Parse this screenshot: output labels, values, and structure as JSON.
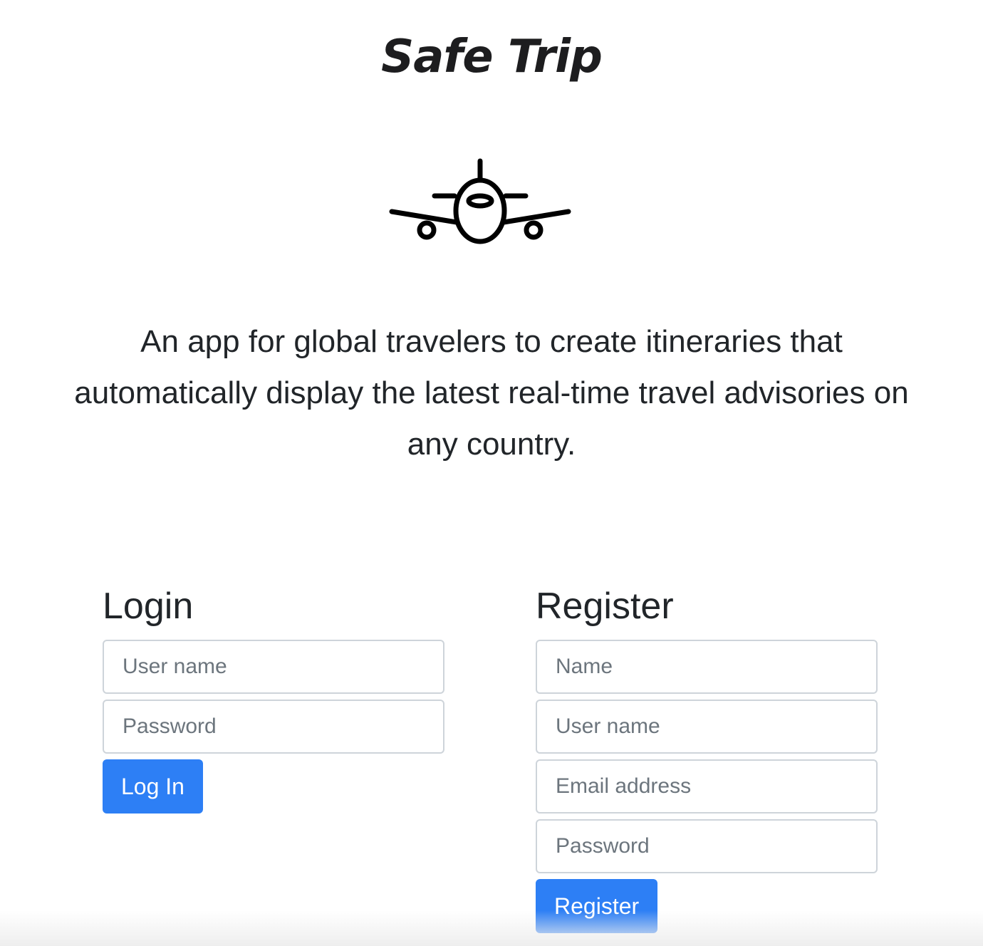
{
  "app": {
    "title": "Safe Trip",
    "tagline": "An app for global travelers to create itineraries that automatically display the latest real-time travel advisories on any country.",
    "icon": "airplane-icon"
  },
  "login": {
    "title": "Login",
    "username_placeholder": "User name",
    "password_placeholder": "Password",
    "submit_label": "Log In"
  },
  "register": {
    "title": "Register",
    "name_placeholder": "Name",
    "username_placeholder": "User name",
    "email_placeholder": "Email address",
    "password_placeholder": "Password",
    "submit_label": "Register"
  },
  "colors": {
    "primary": "#2d7ff5",
    "text": "#212529",
    "border": "#ced4da",
    "placeholder": "#6c757d"
  }
}
